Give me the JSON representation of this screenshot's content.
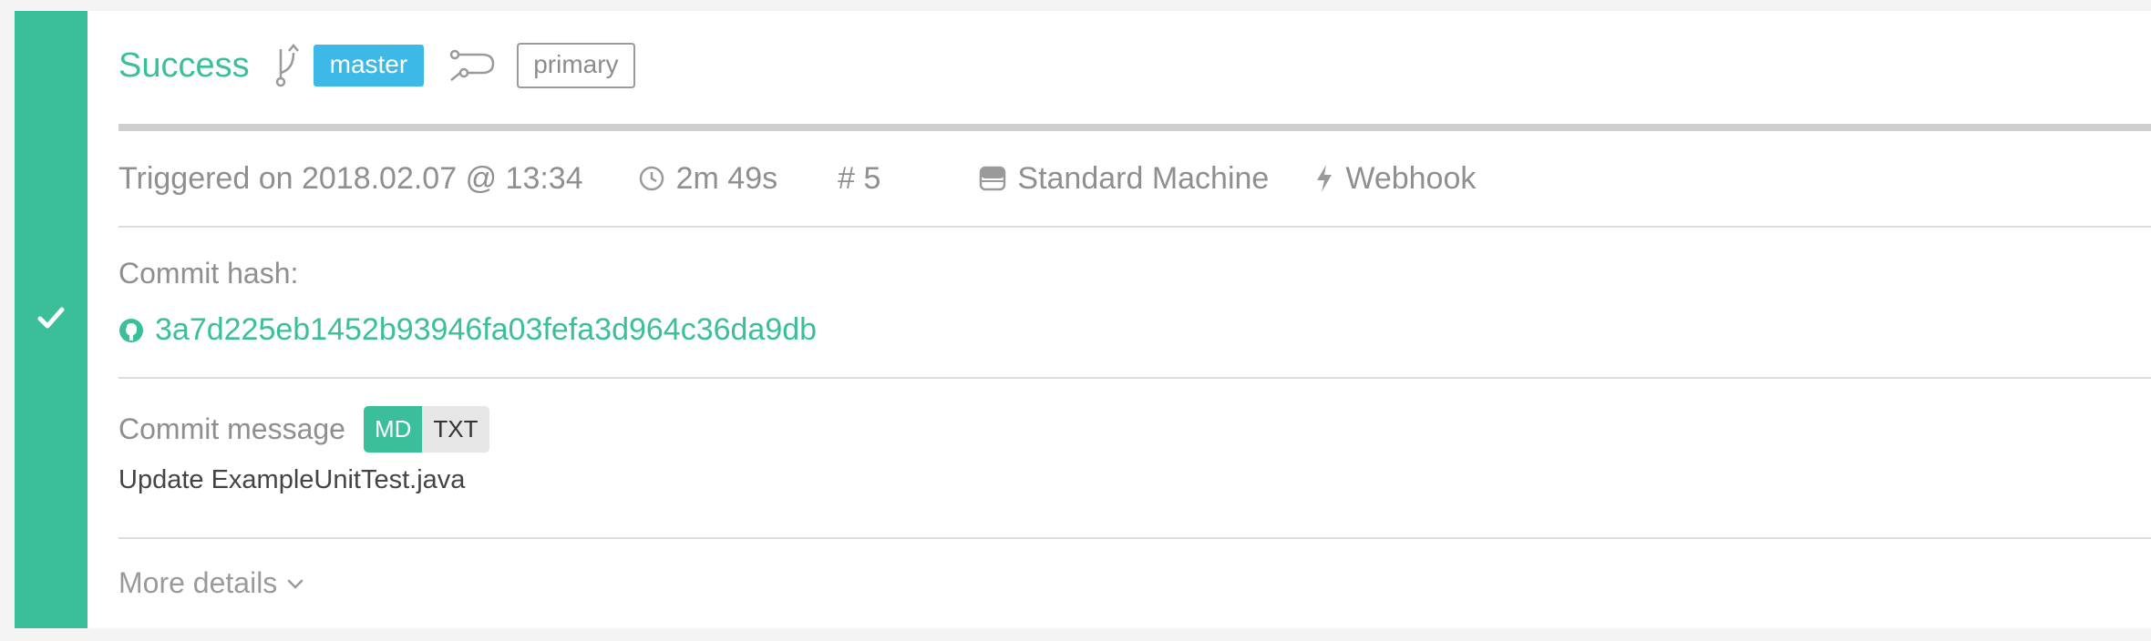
{
  "build": {
    "status": "Success",
    "branch": "master",
    "workflow": "primary"
  },
  "meta": {
    "triggered": "Triggered on 2018.02.07 @ 13:34",
    "duration": "2m 49s",
    "build_number": "# 5",
    "machine": "Standard Machine",
    "trigger_type": "Webhook"
  },
  "commit": {
    "hash_label": "Commit hash:",
    "hash": "3a7d225eb1452b93946fa03fefa3d964c36da9db",
    "message_label": "Commit message",
    "format_md": "MD",
    "format_txt": "TXT",
    "message": "Update ExampleUnitTest.java"
  },
  "more_details_label": "More details",
  "icons": {
    "status": "checkmark-icon",
    "branch": "git-branch-icon",
    "workflow": "workflow-icon",
    "duration": "clock-icon",
    "machine": "machine-icon",
    "trigger": "lightning-icon",
    "repo": "github-icon",
    "expand": "chevron-down-icon"
  },
  "colors": {
    "success": "#3bbf9a",
    "branch_badge": "#3db9e8"
  }
}
